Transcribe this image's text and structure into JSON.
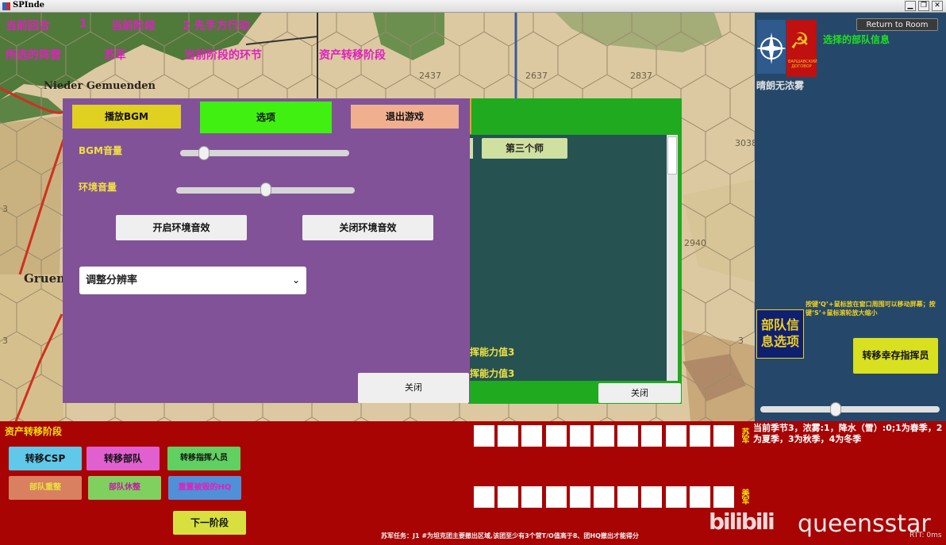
{
  "window": {
    "title": "SPInde",
    "minimize": "▁",
    "restore": "❐",
    "close": "✕"
  },
  "hud": {
    "turn_label": "当前回合",
    "turn_value": "1",
    "phase_label": "当前阶段",
    "phase_value": "2 先手方行动",
    "camp_label": "所选的阵营",
    "camp_value": "苏军",
    "segment_label": "当前阶段的环节",
    "segment_value": "资产转移阶段"
  },
  "map": {
    "town_niedergemuenden": "Nieder Gemuenden",
    "town_gruen": "Gruen",
    "hex_numbers": [
      "2437",
      "2637",
      "2837",
      "3038",
      "2940",
      "3",
      "3",
      "3"
    ]
  },
  "options": {
    "tab_bgm": "播放BGM",
    "tab_options": "选项",
    "tab_exit": "退出游戏",
    "bgm_volume_label": "BGM音量",
    "bgm_volume": 0.14,
    "env_volume_label": "环境音量",
    "env_volume": 0.5,
    "env_on": "开启环境音效",
    "env_off": "关闭环境音效",
    "resolution_placeholder": "调整分辨率",
    "close": "关闭",
    "colors": {
      "panel": "#825299",
      "tab_bgm": "#e0d020",
      "tab_options": "#40f010",
      "tab_exit": "#f0b090"
    }
  },
  "division_panel": {
    "third_division": "第三个师",
    "command_ability_1": "挥能力值3",
    "command_ability_2": "挥能力值3",
    "close": "关闭"
  },
  "sidebar": {
    "return_button": "Return to Room",
    "selected_unit_info": "选择的部队信息",
    "weather": "晴朗无浓雾",
    "emblem_ussr": "☭",
    "emblem_nato": "✦",
    "ussr_emblem_caption": "ВАРШАВСКИЙ ДОГОВОР",
    "hint": "按键‘Q’+鼠标放在窗口周围可以移动屏幕；按键‘S’+鼠标滚轮放大缩小",
    "unit_info_options": "部队信息选项",
    "transfer_surviving_commander": "转移幸存指挥员",
    "slider_value": 0.42
  },
  "bottom": {
    "phase_title": "资产转移阶段",
    "btn_transfer_csp": "转移CSP",
    "btn_transfer_unit": "转移部队",
    "btn_transfer_commander": "转移指挥人员",
    "btn_grey1": "部队重整",
    "btn_rest": "部队休整",
    "btn_rebuild_hq": "重置被毁的HQ",
    "btn_next_phase": "下一阶段",
    "soviet_label": "苏军",
    "us_label": "美军",
    "season_info": "当前季节3，浓雾:1，降水（雪）:0;1为春季，2为夏季，3为秋季，4为冬季",
    "mission": "苏军任务：J1 #为坦克团主要撤出区域,该团至少有3个营T/O值高于8、团HQ撤出才能得分",
    "watermark": "queensstar",
    "watermark_logo": "bilibili",
    "rtt": "RTT: 0ms"
  }
}
